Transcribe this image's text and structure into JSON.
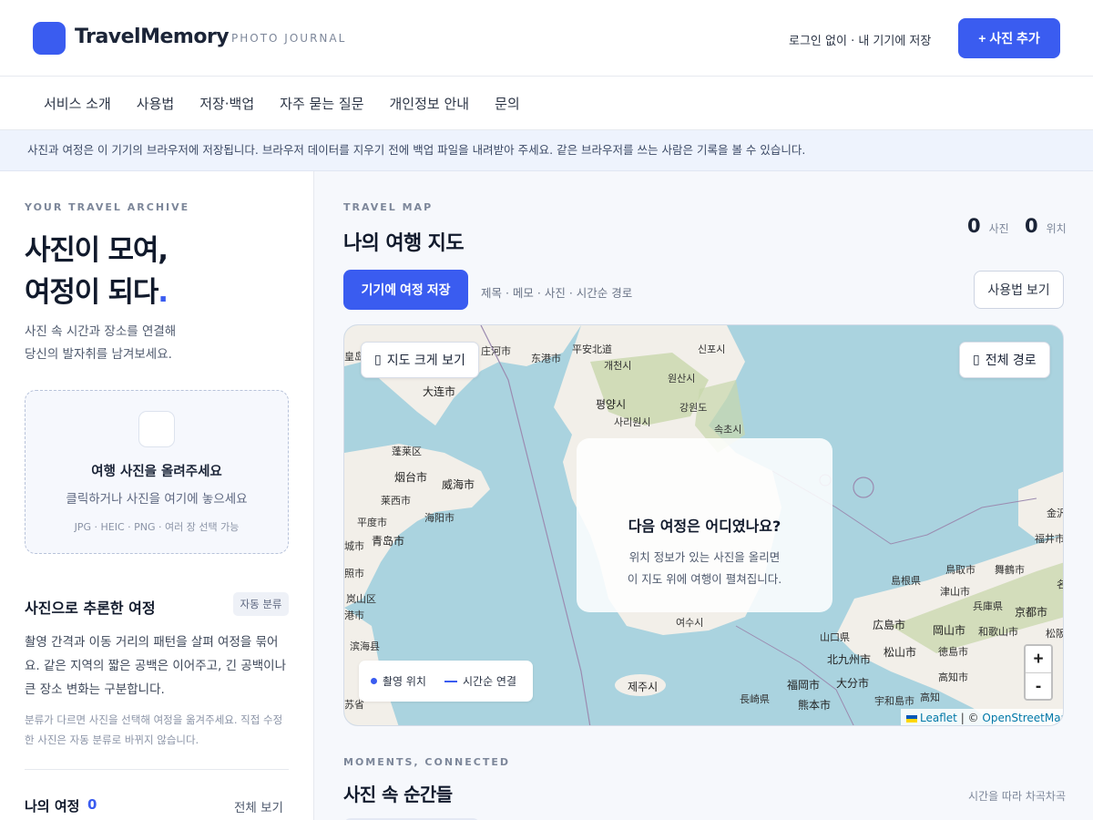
{
  "header": {
    "brand": "TravelMemory",
    "brand_sub": "PHOTO JOURNAL",
    "note": "로그인 없이 · 내 기기에 저장",
    "add_button": "+ 사진 추가"
  },
  "nav": {
    "items": [
      "서비스 소개",
      "사용법",
      "저장·백업",
      "자주 묻는 질문",
      "개인정보 안내",
      "문의"
    ]
  },
  "notice": "사진과 여정은 이 기기의 브라우저에 저장됩니다. 브라우저 데이터를 지우기 전에 백업 파일을 내려받아 주세요. 같은 브라우저를 쓰는 사람은 기록을 볼 수 있습니다.",
  "sidebar": {
    "kicker": "YOUR TRAVEL ARCHIVE",
    "title_line1": "사진이 모여,",
    "title_line2": "여정이 되다",
    "title_dot": ".",
    "desc_line1": "사진 속 시간과 장소를 연결해",
    "desc_line2": "당신의 발자취를 남겨보세요.",
    "dropzone": {
      "title": "여행 사진을 올려주세요",
      "sub": "클릭하거나 사진을 여기에 놓으세요",
      "hint": "JPG · HEIC · PNG · 여러 장 선택 가능"
    },
    "inferred": {
      "title": "사진으로 추론한 여정",
      "badge": "자동 분류",
      "desc": "촬영 간격과 이동 거리의 패턴을 살펴 여정을 묶어요. 같은 지역의 짧은 공백은 이어주고, 긴 공백이나 큰 장소 변화는 구분합니다.",
      "note": "분류가 다르면 사진을 선택해 여정을 옮겨주세요. 직접 수정한 사진은 자동 분류로 바뀌지 않습니다."
    },
    "trips": {
      "label": "나의 여정",
      "count": "0",
      "view_all": "전체 보기"
    }
  },
  "main": {
    "kicker": "TRAVEL MAP",
    "title": "나의 여행 지도",
    "stats": {
      "photos_count": "0",
      "photos_label": "사진",
      "places_count": "0",
      "places_label": "위치"
    },
    "save_button": "기기에 여정 저장",
    "save_hint": "제목 · 메모 · 사진 · 시간순 경로",
    "howto_button": "사용법 보기",
    "map": {
      "expand_button": "지도 크게 보기",
      "route_button": "전체 경로",
      "overlay_title": "다음 여정은 어디였나요?",
      "overlay_line1": "위치 정보가 있는 사진을 올리면",
      "overlay_line2": "이 지도 위에 여행이 펼쳐집니다.",
      "legend_point": "촬영 위치",
      "legend_line": "시간순 연결",
      "zoom_in": "+",
      "zoom_out": "-",
      "attribution_leaflet": "Leaflet",
      "attribution_sep": "| ©",
      "attribution_osm": "OpenStreetMap",
      "labels": [
        "庄河市",
        "东港市",
        "平安北道",
        "신포시",
        "皇岛",
        "大连市",
        "개천시",
        "원산시",
        "평양시",
        "강원도",
        "사리원시",
        "속초시",
        "蓬莱区",
        "烟台市",
        "威海市",
        "莱西市",
        "平度市",
        "海阳市",
        "青岛市",
        "城市",
        "照市",
        "岚山区",
        "港市",
        "滨海县",
        "苏省",
        "제주시",
        "여수시",
        "金沢",
        "福井市",
        "鳥取市",
        "舞鶴市",
        "島根県",
        "津山市",
        "兵庫県",
        "京都市",
        "山口県",
        "広島市",
        "岡山市",
        "和歌山市",
        "松阪",
        "北九州市",
        "松山市",
        "徳島市",
        "福岡市",
        "大分市",
        "高知市",
        "長崎県",
        "熊本市",
        "宇和島市",
        "高知",
        "名"
      ]
    },
    "moments": {
      "kicker": "MOMENTS, CONNECTED",
      "title": "사진 속 순간들",
      "hint": "시간을 따라 차곡차곡"
    }
  },
  "colors": {
    "accent": "#3a5cf0",
    "sea": "#aad3df",
    "land": "#f2efe9",
    "forest": "#c8d7ab"
  }
}
